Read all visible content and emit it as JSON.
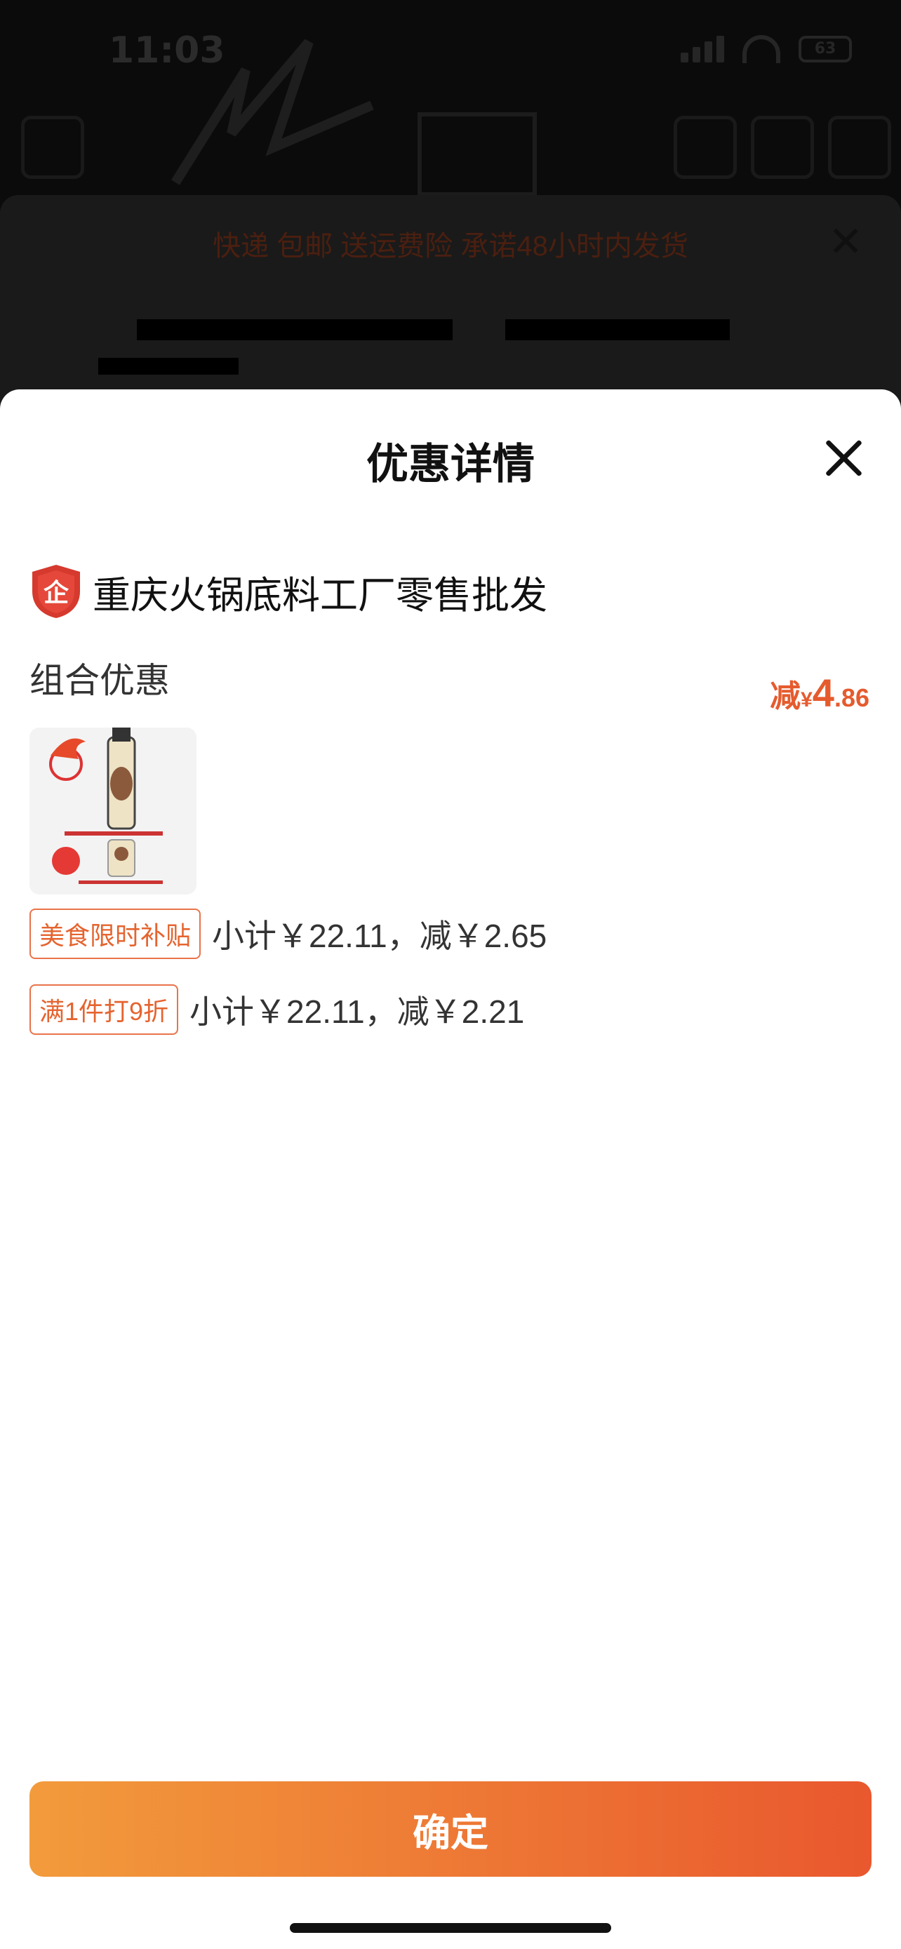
{
  "status_bar": {
    "time": "11:03",
    "battery": "63"
  },
  "background": {
    "banner": "快递 包邮 送运费险 承诺48小时内发货"
  },
  "modal": {
    "title": "优惠详情",
    "shop_name": "重庆火锅底料工厂零售批发",
    "combo_label": "组合优惠",
    "discount": {
      "prefix": "减",
      "currency": "¥",
      "integer": "4",
      "decimal": ".86"
    },
    "promotions": [
      {
        "tag": "美食限时补贴",
        "text": "小计￥22.11，减￥2.65"
      },
      {
        "tag": "满1件打9折",
        "text": "小计￥22.11，减￥2.21"
      }
    ],
    "confirm_label": "确定"
  },
  "colors": {
    "accent": "#e5642f",
    "button_start": "#f29b3c",
    "button_end": "#e9582e"
  }
}
